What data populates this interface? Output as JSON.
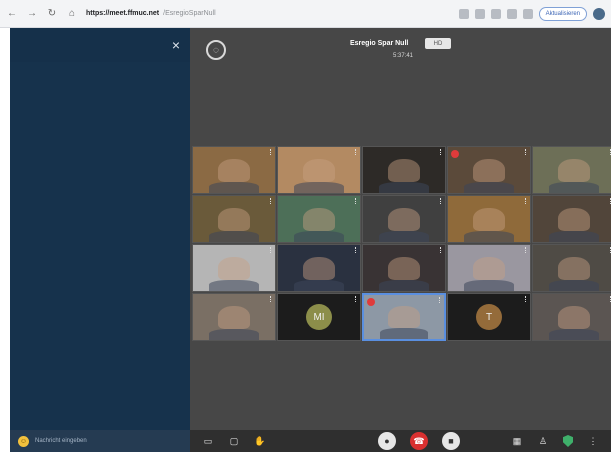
{
  "browser": {
    "url_host": "https://meet.ffmuc.net",
    "url_path": "/EsregioSparNull",
    "update_label": "Aktualisieren"
  },
  "chat": {
    "close_label": "×",
    "placeholder": "Nachricht eingeben"
  },
  "meeting": {
    "title": "Esregio Spar Null",
    "badge": "HD",
    "timer": "5:37:41"
  },
  "participants": [
    {
      "type": "video",
      "bg": "#8b6a44",
      "muted": false
    },
    {
      "type": "video",
      "bg": "#b38a62",
      "muted": false
    },
    {
      "type": "video",
      "bg": "#2d2a27",
      "muted": false
    },
    {
      "type": "video",
      "bg": "#5b4a3a",
      "muted": true
    },
    {
      "type": "video",
      "bg": "#6d6f57",
      "muted": false
    },
    {
      "type": "video",
      "bg": "#6a5a3a",
      "muted": false
    },
    {
      "type": "video",
      "bg": "#4d6f58",
      "muted": false
    },
    {
      "type": "video",
      "bg": "#404040",
      "muted": false
    },
    {
      "type": "video",
      "bg": "#8f6a3a",
      "muted": false
    },
    {
      "type": "video",
      "bg": "#51453a",
      "muted": false
    },
    {
      "type": "video",
      "bg": "#b5b5b5",
      "muted": false
    },
    {
      "type": "video",
      "bg": "#2a3140",
      "muted": false
    },
    {
      "type": "video",
      "bg": "#393334",
      "muted": false
    },
    {
      "type": "video",
      "bg": "#9a97a0",
      "muted": false
    },
    {
      "type": "video",
      "bg": "#4f4b45",
      "muted": false
    },
    {
      "type": "video",
      "bg": "#7a6f64",
      "muted": false
    },
    {
      "type": "avatar",
      "bg": "#1c1c1c",
      "initials": "MI",
      "avatar_color": "#8c8e4a",
      "muted": false
    },
    {
      "type": "video",
      "bg": "#8d98a5",
      "muted": true,
      "active": true
    },
    {
      "type": "avatar",
      "bg": "#1c1c1c",
      "initials": "T",
      "avatar_color": "#946b3a",
      "muted": false
    },
    {
      "type": "video",
      "bg": "#5b5552",
      "muted": false
    }
  ],
  "toolbar": {
    "chat_icon": "▭",
    "screen_icon": "▢",
    "hand_icon": "✋",
    "mic_icon": "●",
    "hangup_icon": "☎",
    "camera_icon": "■",
    "tile_icon": "▦",
    "people_icon": "♙",
    "more_icon": "⋮"
  }
}
